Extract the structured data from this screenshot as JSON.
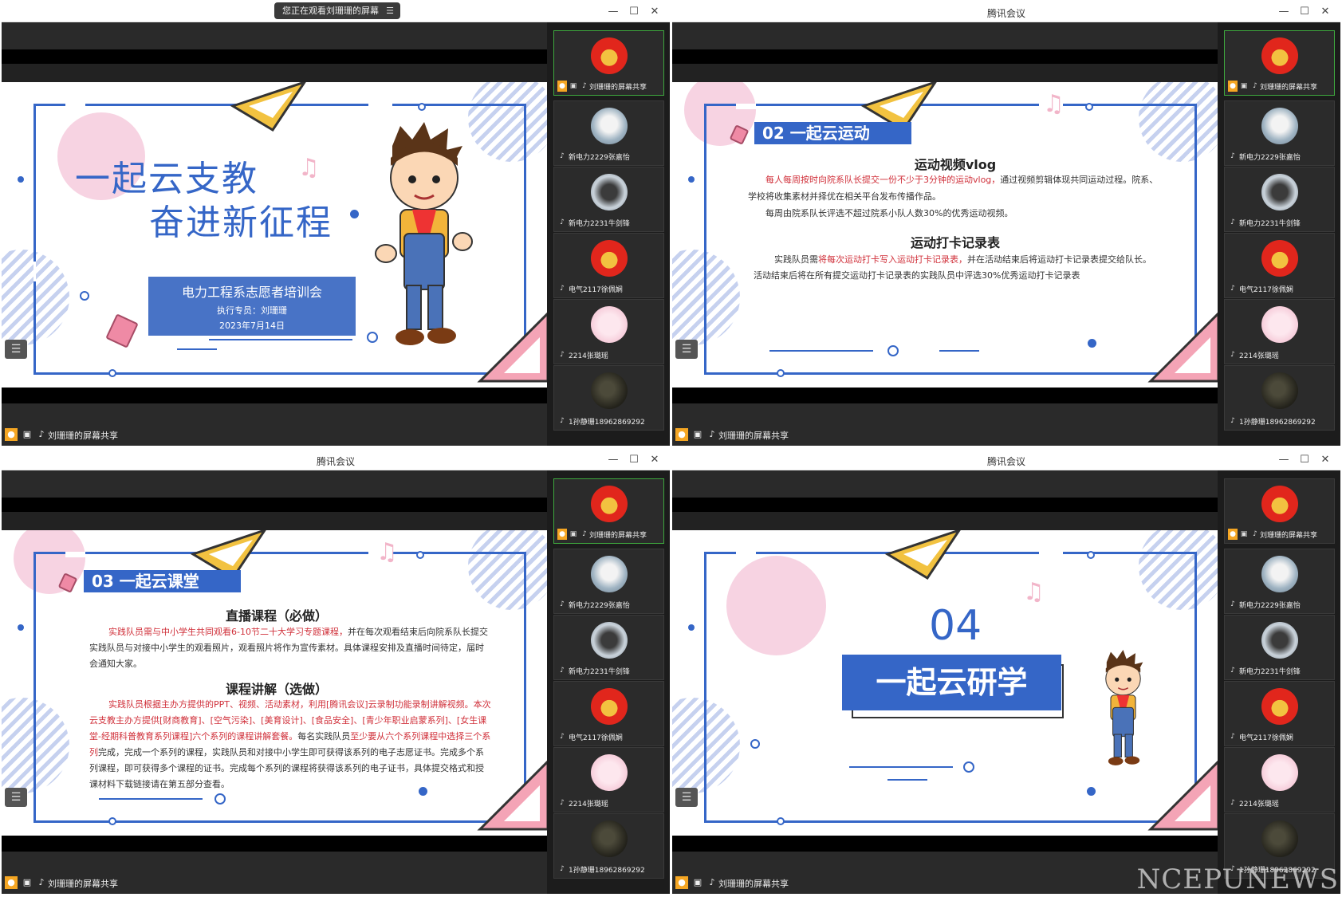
{
  "app": {
    "window_title": "腾讯会议",
    "share_pill": "您正在观看刘珊珊的屏幕",
    "status_text": "刘珊珊的屏幕共享",
    "watermark": "NCEPUNEWS",
    "controls": {
      "min": "—",
      "max": "☐",
      "close": "✕"
    }
  },
  "participants": [
    {
      "name": "刘珊珊的屏幕共享",
      "avatar": "youth-league-badge-icon"
    },
    {
      "name": "新电力2229张嘉怡",
      "avatar": "mist-landscape-avatar"
    },
    {
      "name": "新电力2231牛剑锋",
      "avatar": "study-avatar"
    },
    {
      "name": "电气2117徐佩娴",
      "avatar": "youth-league-badge-icon"
    },
    {
      "name": "2214张璐瑶",
      "avatar": "pink-avatar"
    },
    {
      "name": "1孙静珊18962869292",
      "avatar": "dark-avatar"
    }
  ],
  "slide1": {
    "title_line1": "一起云支教",
    "title_line2": "奋进新征程",
    "box_title": "电力工程系志愿者培训会",
    "box_speaker": "执行专员：刘珊珊",
    "box_date": "2023年7月14日"
  },
  "slide2": {
    "header": "02 一起云运动",
    "sub1": "运动视频vlog",
    "p1_red": "每人每周按时向院系队长提交一份不少于3分钟的运动vlog，",
    "p1_rest": "通过视频剪辑体现共同运动过程。院系、学校将收集素材并择优在相关平台发布传播作品。",
    "p2": "每周由院系队长评选不超过院系小队人数30%的优秀运动视频。",
    "sub2": "运动打卡记录表",
    "p3_pre": "实践队员需",
    "p3_red": "将每次运动打卡写入运动打卡记录表，",
    "p3_rest": "并在活动结束后将运动打卡记录表提交给队长。",
    "p4": "活动结束后将在所有提交运动打卡记录表的实践队员中评选30%优秀运动打卡记录表"
  },
  "slide3": {
    "header": "03 一起云课堂",
    "sub1": "直播课程（必做）",
    "p1_red": "实践队员需与中小学生共同观看6-10节二十大学习专题课程，",
    "p1_rest": "并在每次观看结束后向院系队长提交实践队员与对接中小学生的观看照片，观看照片将作为宣传素材。具体课程安排及直播时间待定，届时会通知大家。",
    "sub2": "课程讲解（选做）",
    "p2_red": "实践队员根据主办方提供的PPT、视频、活动素材，利用[腾讯会议]云录制功能录制讲解视频。本次云支教主办方提供[财商教育]、[空气污染]、[美育设计]、[食品安全]、[青少年职业启蒙系列]、[女生课堂-经期科普教育系列课程]六个系列的课程讲解套餐。",
    "p2_mid": "每名实践队员",
    "p2_red2": "至少要从六个系列课程中选择三个系列",
    "p2_rest": "完成，完成一个系列的课程，实践队员和对接中小学生即可获得该系列的电子志愿证书。完成多个系列课程，即可获得多个课程的证书。完成每个系列的课程将获得该系列的电子证书，具体提交格式和授课材料下载链接请在第五部分查看。"
  },
  "slide4": {
    "number": "04",
    "title": "一起云研学"
  },
  "icons": {
    "list": "☰",
    "note": "♫",
    "person": "👤",
    "mic": "🎙",
    "screen": "▣"
  },
  "colors": {
    "accent_blue": "#3566c7",
    "highlight_red": "#d0303a",
    "pink": "#f7d3e2",
    "yellow": "#f2c240"
  }
}
